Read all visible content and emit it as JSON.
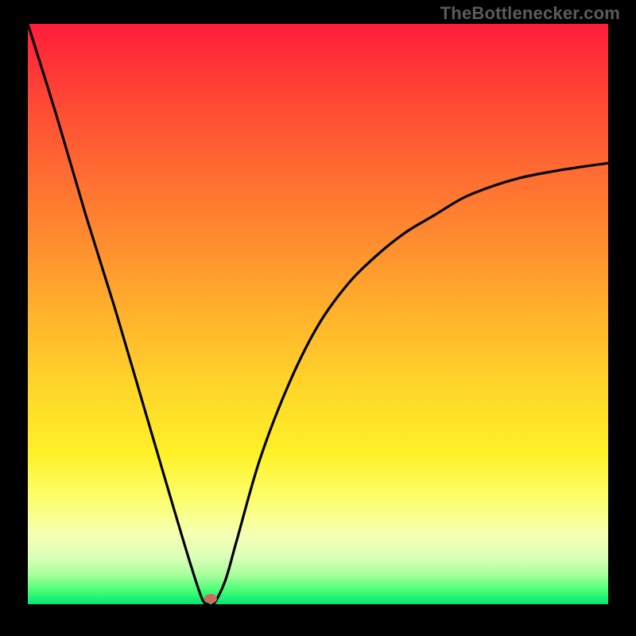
{
  "watermark": "TheBottlenecker.com",
  "chart_data": {
    "type": "line",
    "title": "",
    "xlabel": "",
    "ylabel": "",
    "xlim": [
      0,
      100
    ],
    "ylim": [
      0,
      100
    ],
    "grid": false,
    "legend": false,
    "background": "red-to-green vertical gradient",
    "series": [
      {
        "name": "bottleneck-curve",
        "x": [
          0,
          5,
          10,
          15,
          20,
          25,
          28,
          30,
          31,
          32,
          34,
          36,
          40,
          45,
          50,
          55,
          60,
          65,
          70,
          75,
          80,
          85,
          90,
          95,
          100
        ],
        "values": [
          100,
          84,
          67,
          51,
          34,
          17,
          7,
          1,
          0,
          0,
          4,
          11,
          25,
          38,
          48,
          55,
          60,
          64,
          67,
          70,
          72,
          73.5,
          74.5,
          75.3,
          76
        ]
      }
    ],
    "marker": {
      "x_pct": 31.5,
      "y_pct_from_top": 99.0,
      "color": "#ce6b5e"
    },
    "colors": {
      "curve": "#000000",
      "frame": "#000000",
      "gradient_top": "#ff1c3b",
      "gradient_bottom": "#00e676"
    }
  }
}
